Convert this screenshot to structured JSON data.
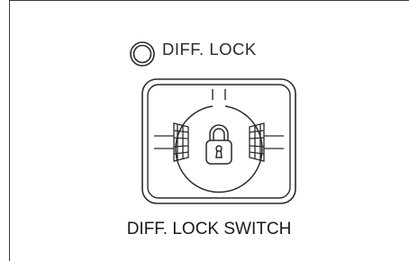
{
  "indicator_label": "DIFF. LOCK",
  "caption": "DIFF. LOCK SWITCH",
  "icons": {
    "indicator": "indicator-lamp-icon",
    "switch": "diff-lock-switch-icon",
    "padlock": "padlock-icon"
  },
  "colors": {
    "line": "#2a2a2a",
    "background": "#ffffff"
  }
}
